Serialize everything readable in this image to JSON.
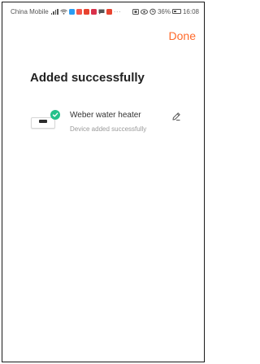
{
  "status_bar": {
    "carrier": "China Mobile",
    "battery": "36%",
    "time": "16:08",
    "more": "···"
  },
  "header": {
    "done_label": "Done"
  },
  "main": {
    "title": "Added successfully",
    "device": {
      "name": "Weber water heater",
      "status": "Device added successfully",
      "icon": "water-heater-icon"
    }
  },
  "colors": {
    "accent": "#ff6a2b",
    "success": "#24c18a",
    "title_text": "#222222",
    "secondary_text": "#9a9a9a"
  }
}
